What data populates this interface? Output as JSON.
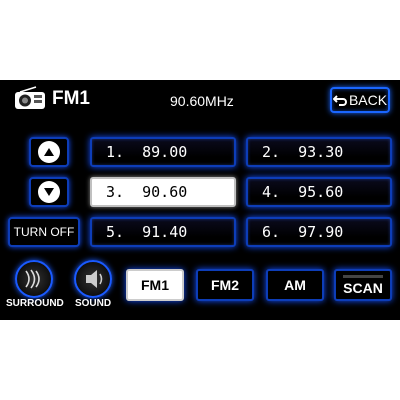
{
  "header": {
    "icon": "radio-icon",
    "band": "FM1",
    "frequency": "90.60MHz",
    "back_label": "BACK"
  },
  "presets": [
    {
      "label": "1.  89.00",
      "active": false
    },
    {
      "label": "2.  93.30",
      "active": false
    },
    {
      "label": "3.  90.60",
      "active": true
    },
    {
      "label": "4.  95.60",
      "active": false
    },
    {
      "label": "5.  91.40",
      "active": false
    },
    {
      "label": "6.  97.90",
      "active": false
    }
  ],
  "controls": {
    "turn_off_label": "TURN OFF",
    "surround_label": "SURROUND",
    "sound_label": "SOUND"
  },
  "bands": [
    {
      "label": "FM1",
      "active": true
    },
    {
      "label": "FM2",
      "active": false
    },
    {
      "label": "AM",
      "active": false
    },
    {
      "label": "SCAN",
      "active": false
    }
  ],
  "colors": {
    "accent": "#1a66ff",
    "background": "#000000"
  }
}
